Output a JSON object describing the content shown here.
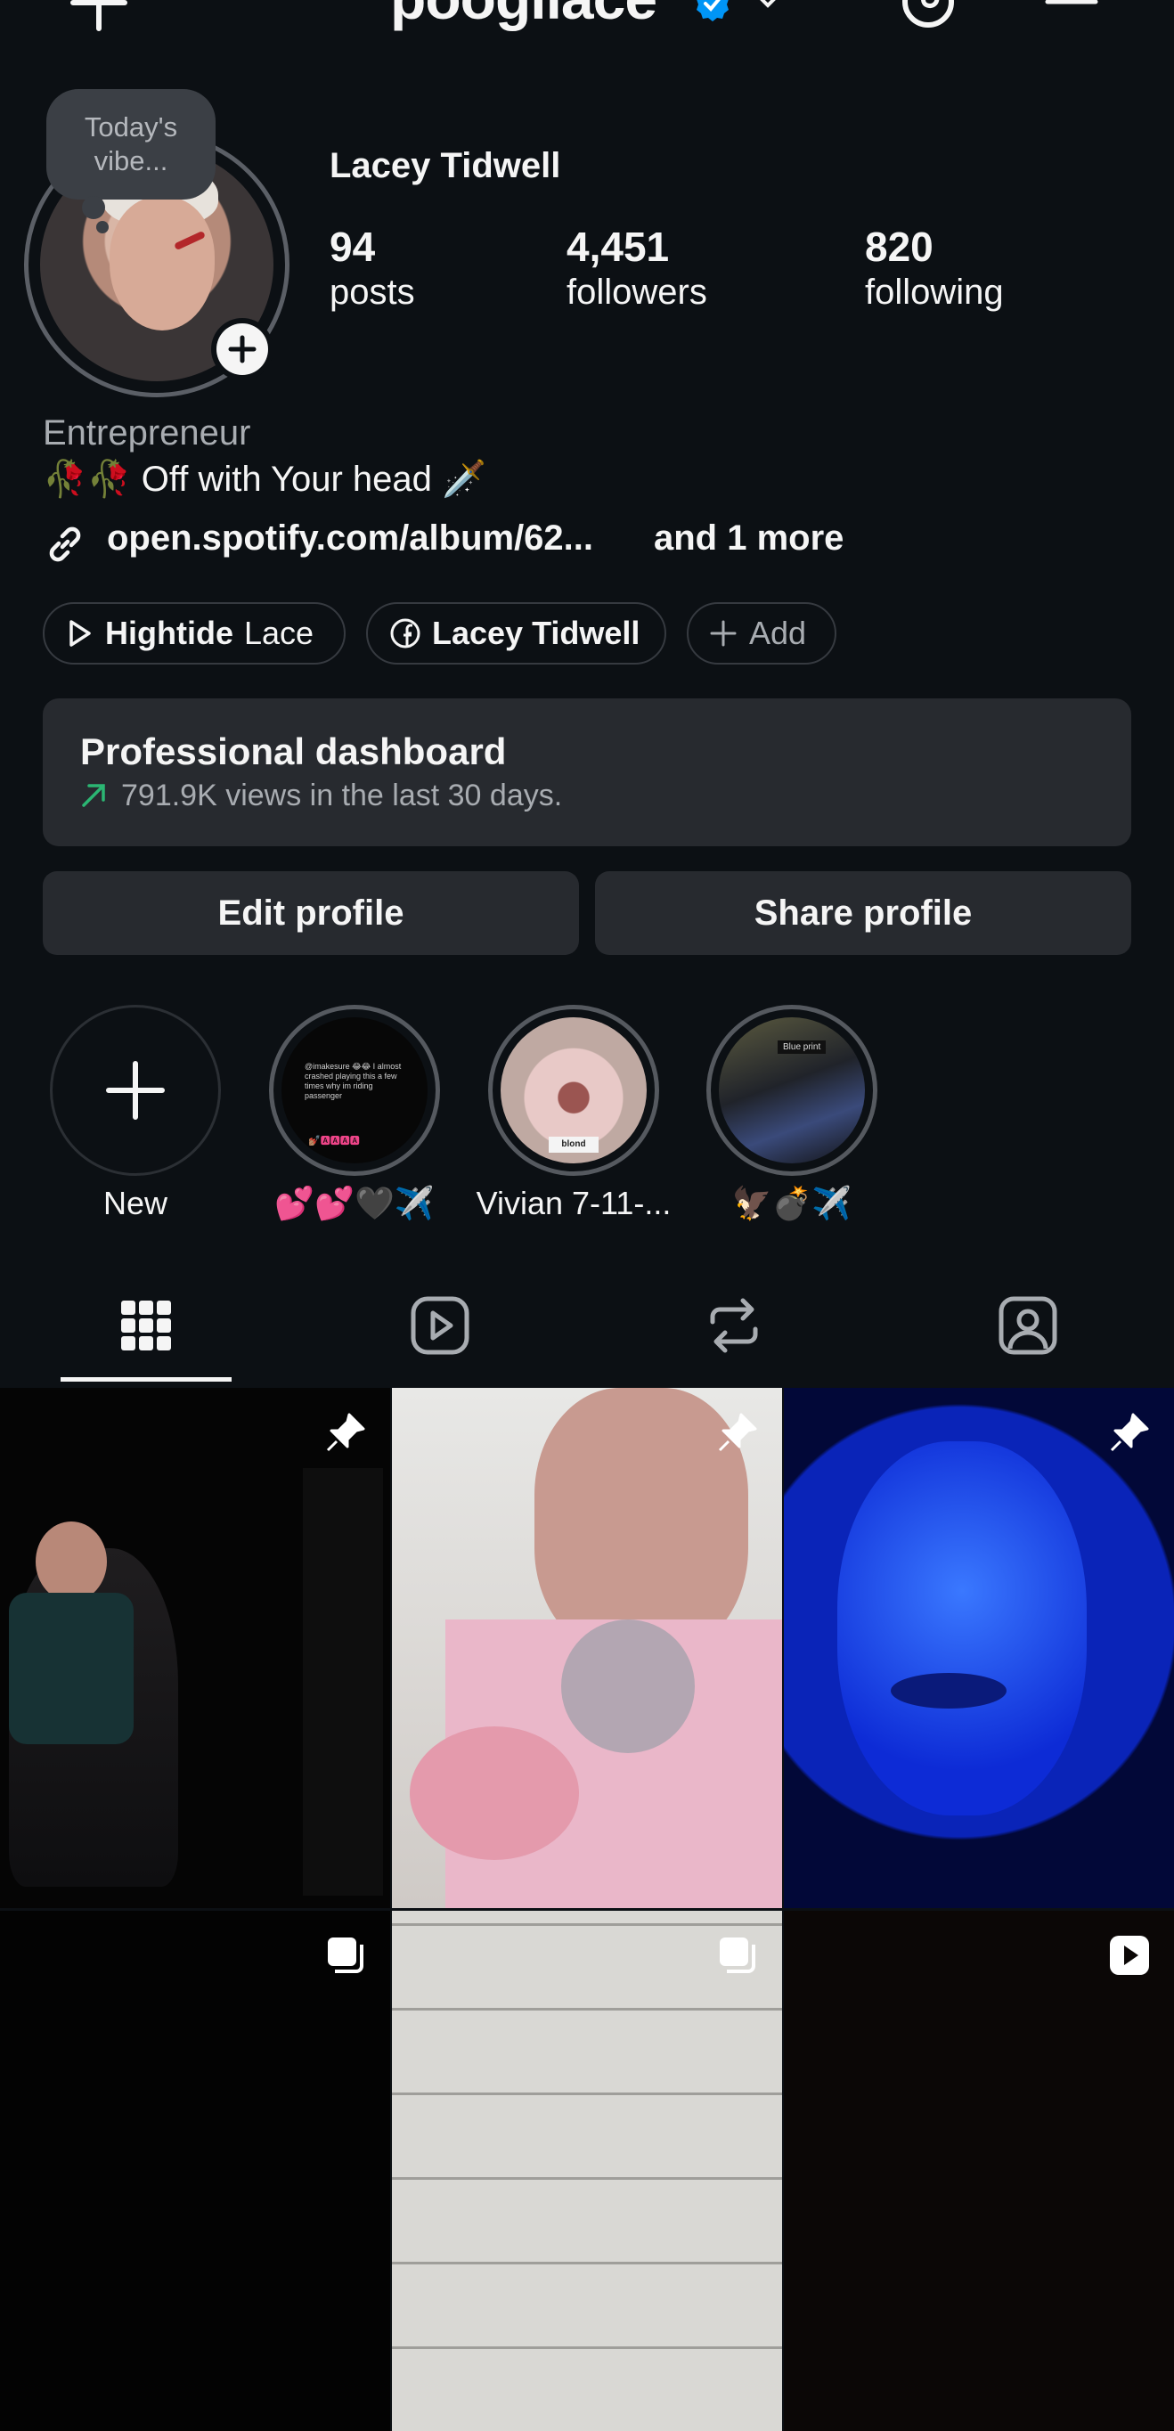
{
  "header": {
    "username": "poogilace",
    "icons": [
      "plus-icon",
      "verified-badge-icon",
      "chevron-down-icon",
      "threads-icon",
      "menu-icon"
    ]
  },
  "profile": {
    "note": "Today's vibe...",
    "full_name": "Lacey Tidwell",
    "stats": [
      {
        "value": "94",
        "label": "posts"
      },
      {
        "value": "4,451",
        "label": "followers"
      },
      {
        "value": "820",
        "label": "following"
      }
    ],
    "category": "Entrepreneur",
    "bio": "🥀🥀 Off with Your head 🗡️",
    "link": "open.spotify.com/album/62...",
    "link_more": "and 1 more"
  },
  "chips": [
    {
      "bold": "Hightide",
      "rest": "Lace",
      "icon": "play-icon"
    },
    {
      "bold": "Lacey Tidwell",
      "rest": "",
      "icon": "facebook-icon"
    },
    {
      "bold": "",
      "rest": "Add",
      "icon": "plus-icon"
    }
  ],
  "dashboard": {
    "title": "Professional dashboard",
    "subtitle": "791.9K views in the last 30 days."
  },
  "actions": {
    "edit": "Edit profile",
    "share": "Share profile"
  },
  "highlights": [
    {
      "label": "New"
    },
    {
      "label": "💕💕🖤✈️"
    },
    {
      "label": "Vivian 7-11-..."
    },
    {
      "label": "🦅💣✈️"
    }
  ],
  "highlight_texts": {
    "h2_caption": "@imakesure 😂😂 I almost crashed playing this a few times why im riding passenger",
    "h2_caption_tail": "💅🏽🅰🅰🅰🅰",
    "h3_caption": "blond",
    "h4_caption": "Blue print"
  },
  "tabs": [
    "grid-icon",
    "reels-icon",
    "reposts-icon",
    "tagged-icon"
  ],
  "colors": {
    "background": "#0c1014",
    "surface": "#272a2f",
    "accent_blue": "#0095f6",
    "up_green": "#2bb673"
  }
}
